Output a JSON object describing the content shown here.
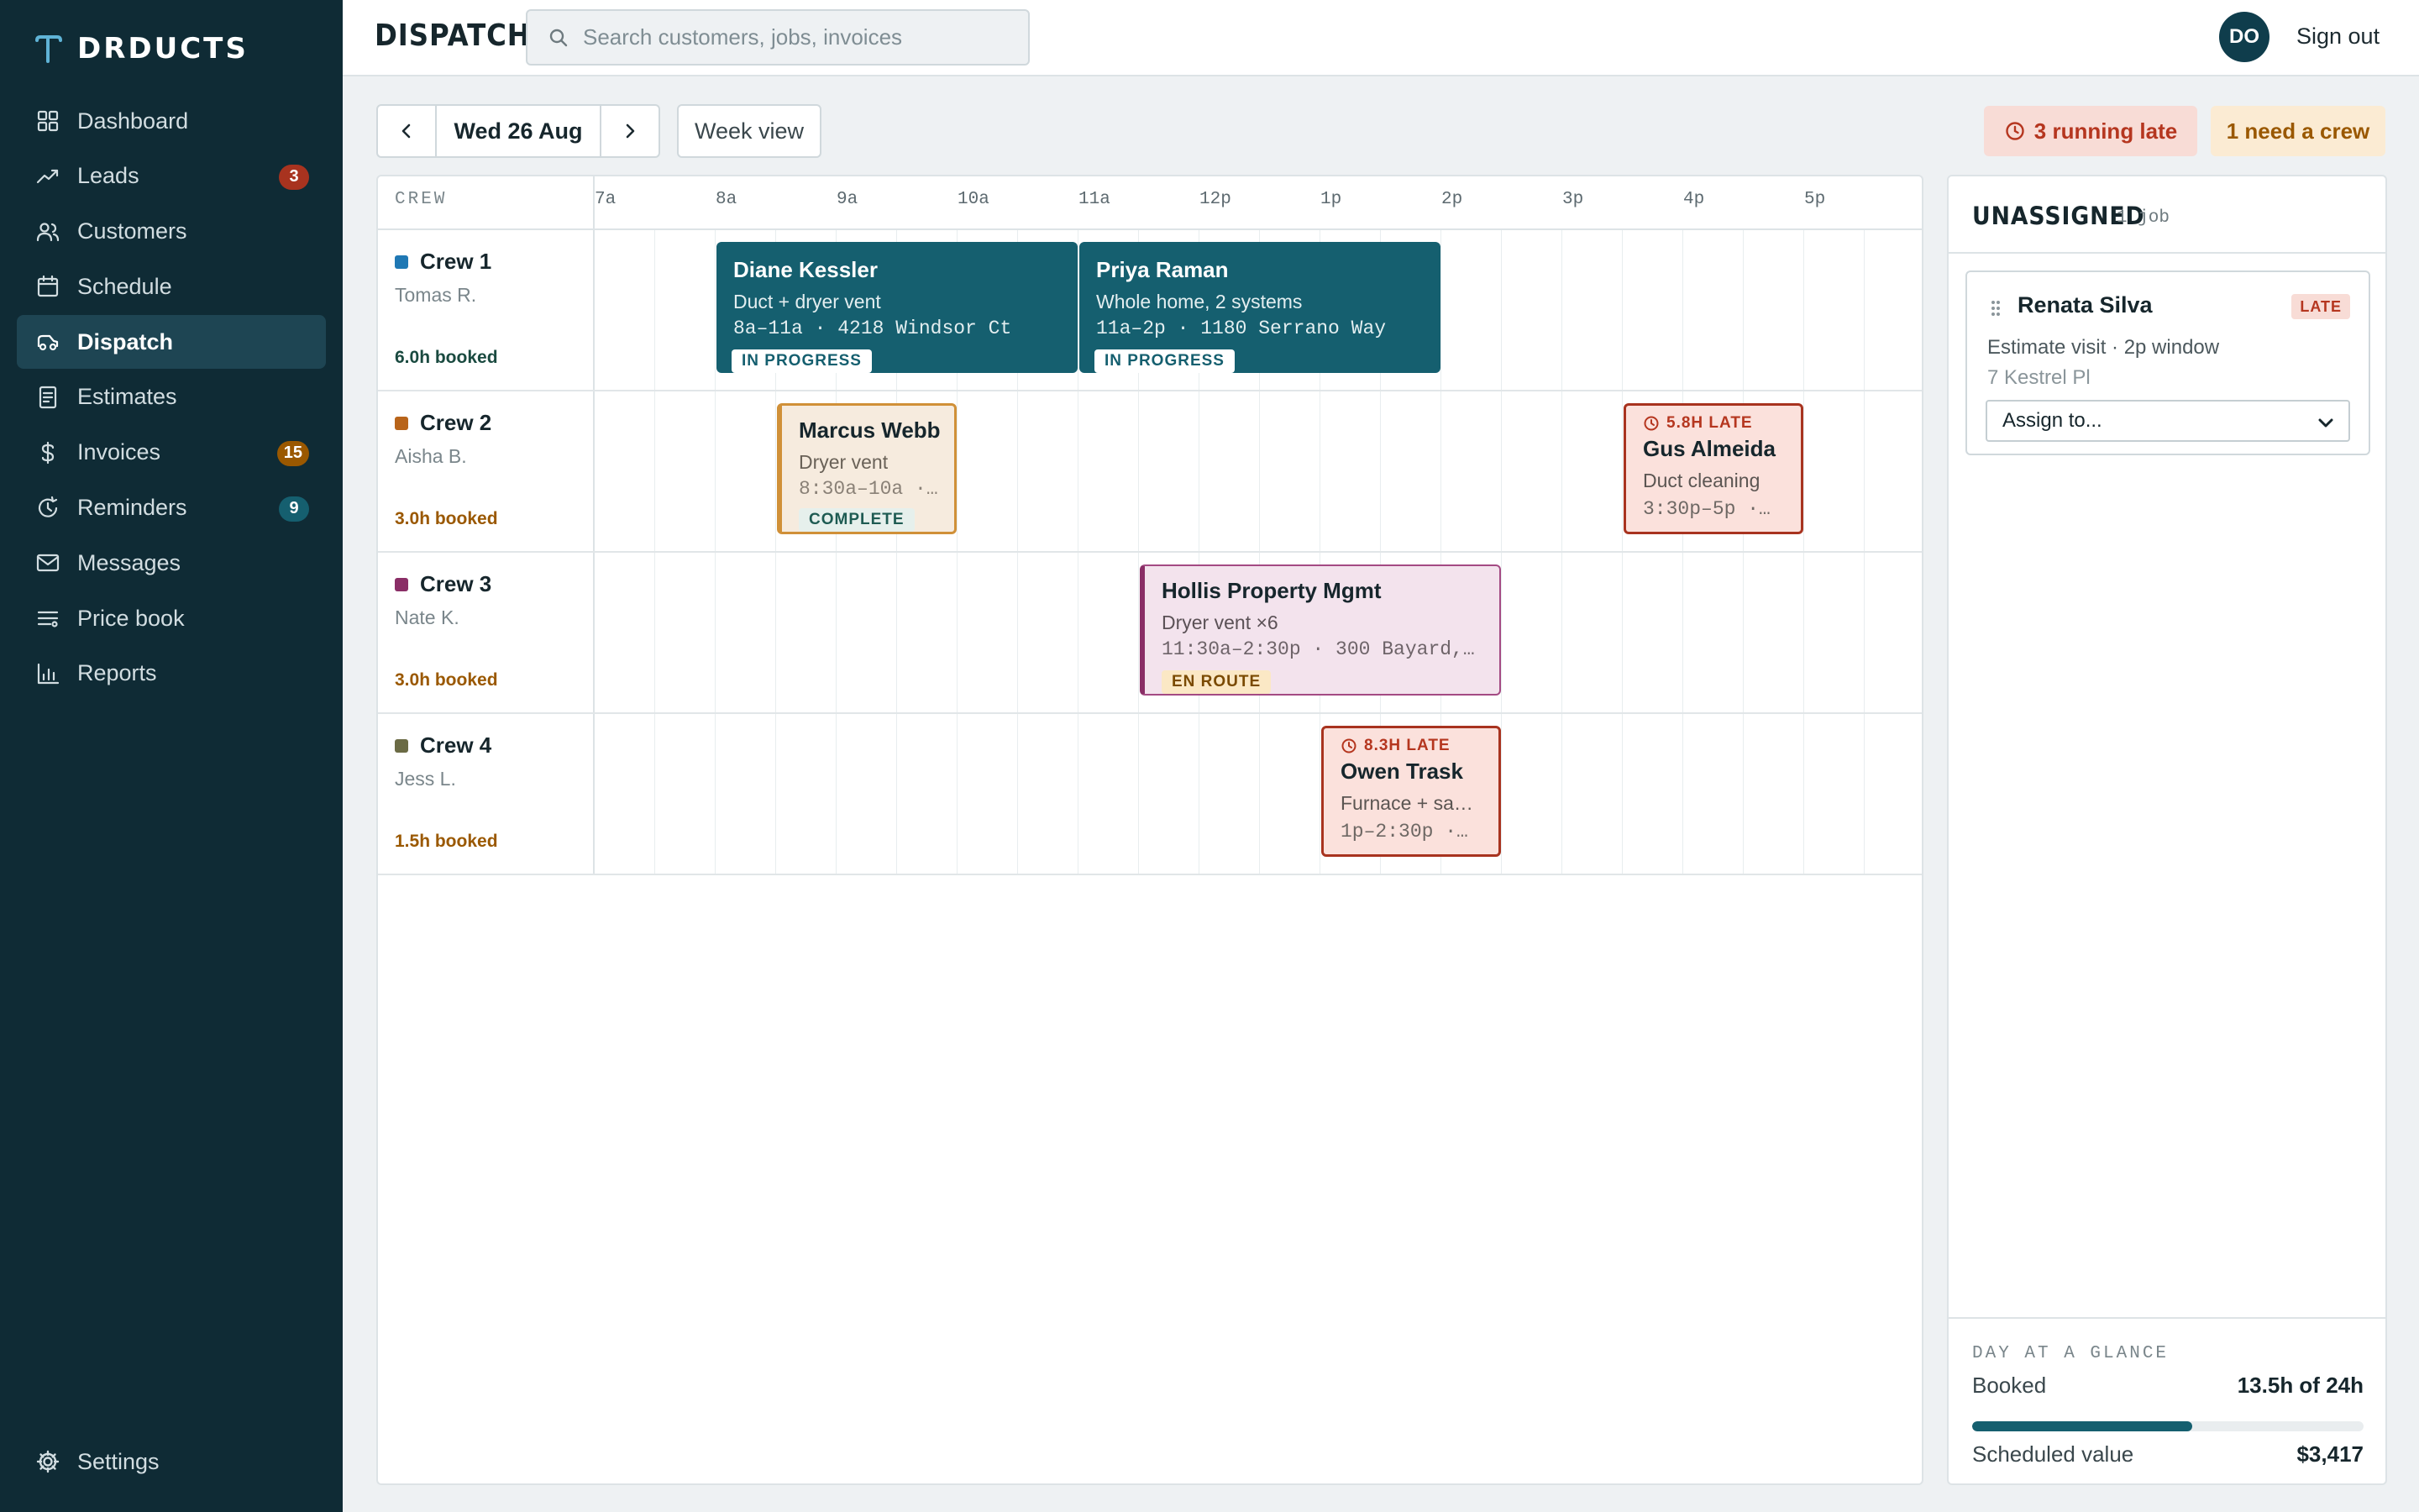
{
  "app": {
    "brand": "DRDUCTS"
  },
  "sidebar": {
    "items": [
      {
        "label": "Dashboard",
        "icon": "dashboard-icon"
      },
      {
        "label": "Leads",
        "icon": "trending-icon",
        "badge": "3",
        "badge_color": "#a8331f"
      },
      {
        "label": "Customers",
        "icon": "users-icon"
      },
      {
        "label": "Schedule",
        "icon": "calendar-icon"
      },
      {
        "label": "Dispatch",
        "icon": "dispatch-icon",
        "active": true
      },
      {
        "label": "Estimates",
        "icon": "document-icon"
      },
      {
        "label": "Invoices",
        "icon": "dollar-icon",
        "badge": "15",
        "badge_color": "#9a5800"
      },
      {
        "label": "Reminders",
        "icon": "reminder-icon",
        "badge": "9",
        "badge_color": "#155f6f"
      },
      {
        "label": "Messages",
        "icon": "mail-icon"
      },
      {
        "label": "Price book",
        "icon": "list-icon"
      },
      {
        "label": "Reports",
        "icon": "bar-chart-icon"
      }
    ],
    "settings_label": "Settings"
  },
  "header": {
    "title": "DISPATCH",
    "search_placeholder": "Search customers, jobs, invoices",
    "avatar_initials": "DO",
    "signout_label": "Sign out"
  },
  "toolbar": {
    "date_label": "Wed 26 Aug",
    "week_view_label": "Week view",
    "late_pill": "3 running late",
    "crew_pill": "1 need a crew"
  },
  "board": {
    "crew_column_label": "CREW",
    "hours": [
      "7a",
      "8a",
      "9a",
      "10a",
      "11a",
      "12p",
      "1p",
      "2p",
      "3p",
      "4p",
      "5p"
    ],
    "crews": [
      {
        "name": "Crew 1",
        "lead": "Tomas R.",
        "booked": "6.0h booked",
        "color": "#1f78b4",
        "booked_color": "#1a4a40",
        "jobs": [
          {
            "customer": "Diane Kessler",
            "desc": "Duct + dryer vent",
            "time": "8a–11a · 4218 Windsor Ct",
            "status": "IN PROGRESS",
            "style": "teal",
            "start": 8,
            "end": 11
          },
          {
            "customer": "Priya Raman",
            "desc": "Whole home, 2 systems",
            "time": "11a–2p · 1180 Serrano Way",
            "status": "IN PROGRESS",
            "style": "teal",
            "start": 11,
            "end": 14
          }
        ]
      },
      {
        "name": "Crew 2",
        "lead": "Aisha B.",
        "booked": "3.0h booked",
        "color": "#b8641a",
        "booked_color": "#9a5800",
        "jobs": [
          {
            "customer": "Marcus Webb",
            "desc": "Dryer vent",
            "time": "8:30a–10a · …",
            "status": "COMPLETE",
            "style": "tan",
            "start": 8.5,
            "end": 10
          },
          {
            "customer": "Gus Almeida",
            "desc": "Duct cleaning",
            "time": "3:30p–5p ·…",
            "late": "5.8H LATE",
            "style": "late",
            "start": 15.5,
            "end": 17
          }
        ]
      },
      {
        "name": "Crew 3",
        "lead": "Nate K.",
        "booked": "3.0h booked",
        "color": "#8a2e66",
        "booked_color": "#9a5800",
        "jobs": [
          {
            "customer": "Hollis Property Mgmt",
            "desc": "Dryer vent ×6",
            "time": "11:30a–2:30p · 300 Bayard,…",
            "status": "EN ROUTE",
            "style": "purple",
            "start": 11.5,
            "end": 14.5
          }
        ]
      },
      {
        "name": "Crew 4",
        "lead": "Jess L.",
        "booked": "1.5h booked",
        "color": "#6b6b45",
        "booked_color": "#9a5800",
        "jobs": [
          {
            "customer": "Owen Trask",
            "desc": "Furnace + sa…",
            "time": "1p–2:30p ·…",
            "late": "8.3H LATE",
            "style": "late",
            "start": 13,
            "end": 14.5
          }
        ]
      }
    ]
  },
  "unassigned": {
    "title": "UNASSIGNED",
    "count": "1 job",
    "card": {
      "name": "Renata Silva",
      "badge": "LATE",
      "desc": "Estimate visit · 2p window",
      "address": "7 Kestrel Pl",
      "assign_placeholder": "Assign to..."
    }
  },
  "glance": {
    "title": "DAY AT A GLANCE",
    "booked_label": "Booked",
    "booked_value": "13.5h of 24h",
    "booked_fraction": 0.5625,
    "value_label": "Scheduled value",
    "value": "$3,417"
  },
  "colors": {
    "sidebar": "#0f2b35",
    "accent": "#155f6f",
    "late": "#b5361f",
    "warning": "#9a5800"
  }
}
